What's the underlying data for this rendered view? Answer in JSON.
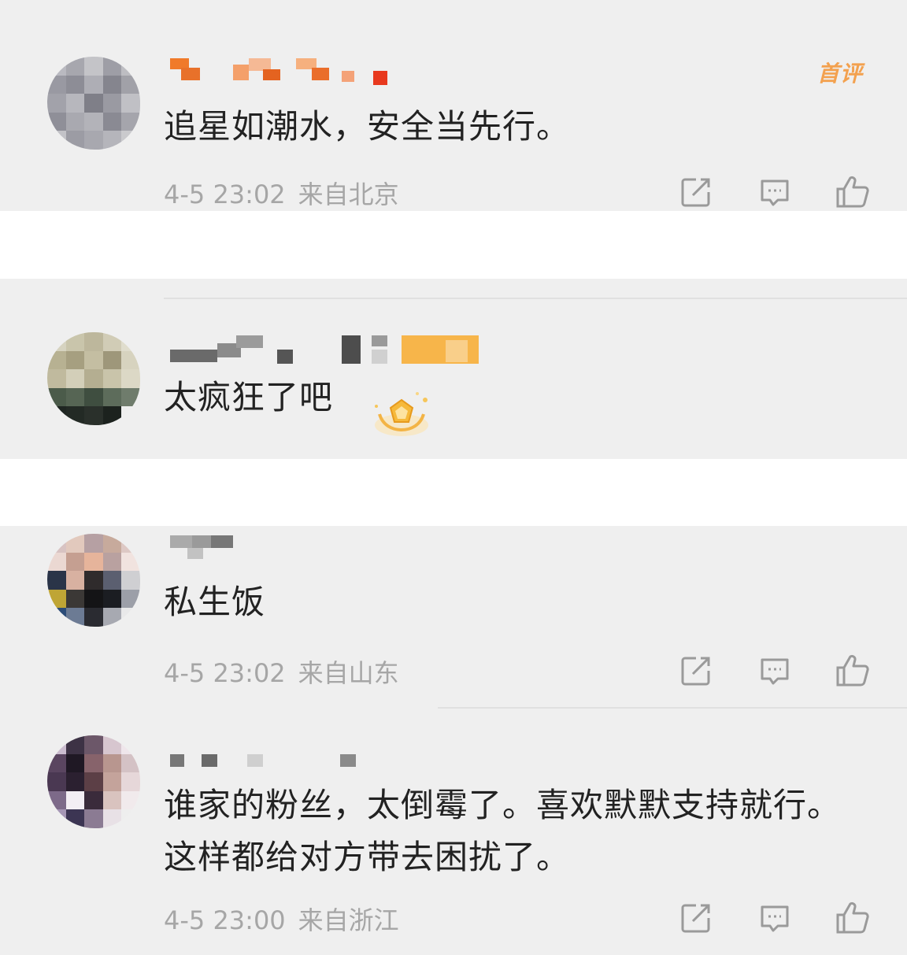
{
  "comments": [
    {
      "text": "追星如潮水，安全当先行。",
      "time": "4-5 23:02",
      "location": "来自北京",
      "badge": "首评"
    },
    {
      "text": "太疯狂了吧"
    },
    {
      "text": "私生饭",
      "time": "4-5 23:02",
      "location": "来自山东"
    },
    {
      "text": "谁家的粉丝，太倒霉了。喜欢默默支持就行。这样都给对方带去困扰了。",
      "time": "4-5 23:00",
      "location": "来自浙江"
    }
  ],
  "icons": {
    "share": "share-icon",
    "reply": "comment-icon",
    "like": "thumbs-up-icon",
    "medal": "medal-badge-icon"
  },
  "colors": {
    "panel_bg": "#efefef",
    "text": "#222222",
    "meta": "#a6a6a6",
    "badge_first": "#f3a14f",
    "icon": "#9a9a9a"
  }
}
